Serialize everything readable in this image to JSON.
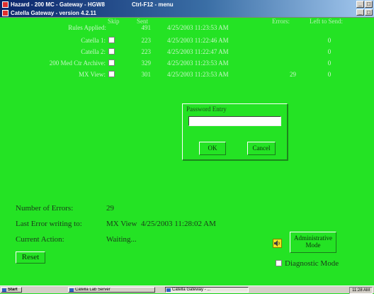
{
  "window": {
    "outer_title": "Hazard - 200 MC - Gateway - HGW8",
    "outer_menu": "Ctrl-F12 - menu",
    "inner_title": "Catella Gateway - version 4.2.11",
    "controls": [
      "_",
      "□"
    ]
  },
  "table": {
    "headers": {
      "skip": "Skip",
      "sent": "Sent",
      "errors": "Errors:",
      "left": "Left to Send:"
    },
    "rules_applied": {
      "label": "Rules Applied:",
      "sent": "491",
      "date": "4/25/2003 11:23:53 AM"
    },
    "rows": [
      {
        "label": "Catella 1:",
        "sent": "223",
        "date": "4/25/2003 11:22:46 AM",
        "errors": "",
        "left": "0"
      },
      {
        "label": "Catella 2:",
        "sent": "223",
        "date": "4/25/2003 11:22:47 AM",
        "errors": "",
        "left": "0"
      },
      {
        "label": "200 Med Ctr Archive:",
        "sent": "329",
        "date": "4/25/2003 11:23:53 AM",
        "errors": "",
        "left": "0"
      },
      {
        "label": "MX View:",
        "sent": "301",
        "date": "4/25/2003 11:23:53 AM",
        "errors": "29",
        "left": "0"
      }
    ]
  },
  "dialog": {
    "title": "Password Entry",
    "password_value": "",
    "ok_label": "OK",
    "cancel_label": "Cancel"
  },
  "status": {
    "errors_label": "Number of Errors:",
    "errors_value": "29",
    "last_error_label": "Last Error writing to:",
    "last_error_value": "MX View  4/25/2003 11:28:02 AM",
    "current_action_label": "Current Action:",
    "current_action_value": "Waiting..."
  },
  "buttons": {
    "reset": "Reset",
    "admin_line1": "Administrative",
    "admin_line2": "Mode",
    "diagnostic": "Diagnostic Mode"
  },
  "taskbar": {
    "start": "Start",
    "items": [
      "Catella Lab Server",
      "Catella Gateway - ..."
    ],
    "clock": "11:28 AM"
  },
  "colors": {
    "background": "#24e324",
    "titlebar_start": "#0a246a",
    "titlebar_end": "#a6caf0"
  },
  "icons": [
    "app-icon",
    "speaker-icon",
    "windows-flag-icon"
  ]
}
